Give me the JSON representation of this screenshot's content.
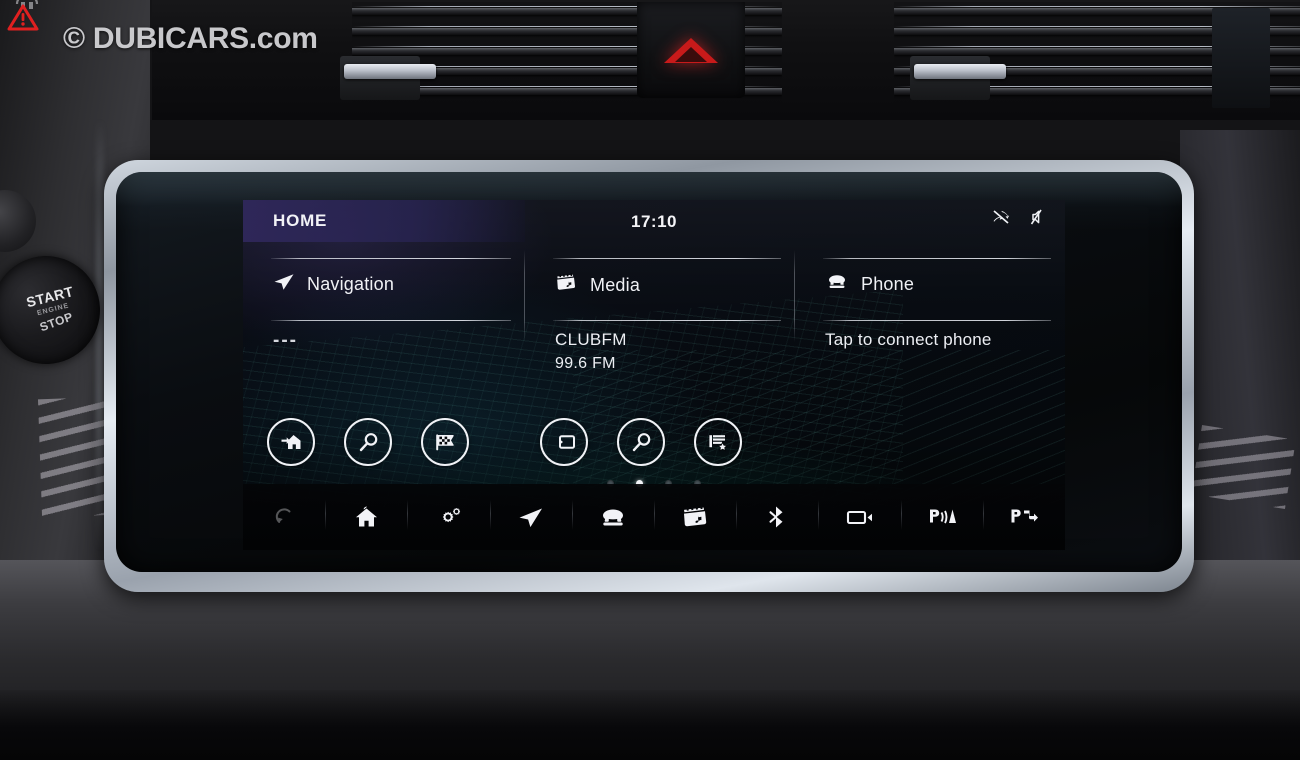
{
  "watermark": {
    "text": "© DUBICARS.com",
    "badge_icon": "warning-triangle-icon",
    "logo_icon": "dubicars-logo-icon"
  },
  "dashboard": {
    "start_button": {
      "line1": "START",
      "line2": "ENGINE",
      "line3": "STOP",
      "name": "engine-start-stop-button"
    },
    "hazard_button": {
      "icon": "hazard-triangle-icon",
      "label": "Hazard warning lights"
    },
    "vents": {
      "left_name": "air-vent-left",
      "right_name": "air-vent-right",
      "slider_name": "vent-direction-slider"
    }
  },
  "screen": {
    "status": {
      "page_title": "HOME",
      "clock": "17:10",
      "icons": [
        {
          "name": "phone-disconnected-icon",
          "label": "Phone not connected"
        },
        {
          "name": "sound-muted-icon",
          "label": "Sound muted"
        }
      ]
    },
    "columns": [
      {
        "id": "navigation",
        "title": "Navigation",
        "icon": "navigation-arrow-icon",
        "body_line1": "---",
        "body_line2": ""
      },
      {
        "id": "media",
        "title": "Media",
        "icon": "media-clapperboard-icon",
        "body_line1": "CLUBFM",
        "body_line2": "99.6 FM"
      },
      {
        "id": "phone",
        "title": "Phone",
        "icon": "phone-handset-icon",
        "body_line1": "Tap to connect phone",
        "body_line2": ""
      }
    ],
    "shortcuts": [
      {
        "name": "go-home-shortcut",
        "icon": "home-arrow-icon",
        "label": "Go home"
      },
      {
        "name": "search-destination-shortcut",
        "icon": "magnifier-icon",
        "label": "Search destination"
      },
      {
        "name": "destinations-shortcut",
        "icon": "checkered-flag-icon",
        "label": "Destinations"
      },
      {
        "name": "media-source-shortcut",
        "icon": "source-input-icon",
        "label": "Media source"
      },
      {
        "name": "media-search-shortcut",
        "icon": "magnifier-icon",
        "label": "Search media"
      },
      {
        "name": "playlists-shortcut",
        "icon": "playlist-star-icon",
        "label": "Playlists and favourites"
      }
    ],
    "pagination": {
      "total": 4,
      "active_index": 1
    },
    "bottom_bar": [
      {
        "name": "back-button",
        "icon": "back-arrow-icon",
        "label": "Back",
        "dimmed": true
      },
      {
        "name": "home-button",
        "icon": "home-icon",
        "label": "Home",
        "dimmed": false
      },
      {
        "name": "settings-button",
        "icon": "gears-icon",
        "label": "Settings",
        "dimmed": false
      },
      {
        "name": "navigation-button",
        "icon": "navigation-arrow-icon",
        "label": "Navigation",
        "dimmed": false
      },
      {
        "name": "phone-button",
        "icon": "phone-handset-icon",
        "label": "Phone",
        "dimmed": false
      },
      {
        "name": "media-button",
        "icon": "media-clapperboard-icon",
        "label": "Media",
        "dimmed": false
      },
      {
        "name": "bluetooth-button",
        "icon": "bluetooth-icon",
        "label": "Bluetooth",
        "dimmed": false
      },
      {
        "name": "camera-button",
        "icon": "camera-icon",
        "label": "Camera",
        "dimmed": false
      },
      {
        "name": "park-sensors-button",
        "icon": "park-sensors-icon",
        "label": "Park distance control",
        "dimmed": false
      },
      {
        "name": "park-assist-button",
        "icon": "park-assist-icon",
        "label": "Park assist",
        "dimmed": false
      }
    ]
  },
  "colors": {
    "screen_accent_green": "#16968 7",
    "screen_header_purple": "#30285c",
    "icon_white": "#f0f2f6",
    "hazard_red": "#c81a1a",
    "chrome": "#cfd6de"
  }
}
